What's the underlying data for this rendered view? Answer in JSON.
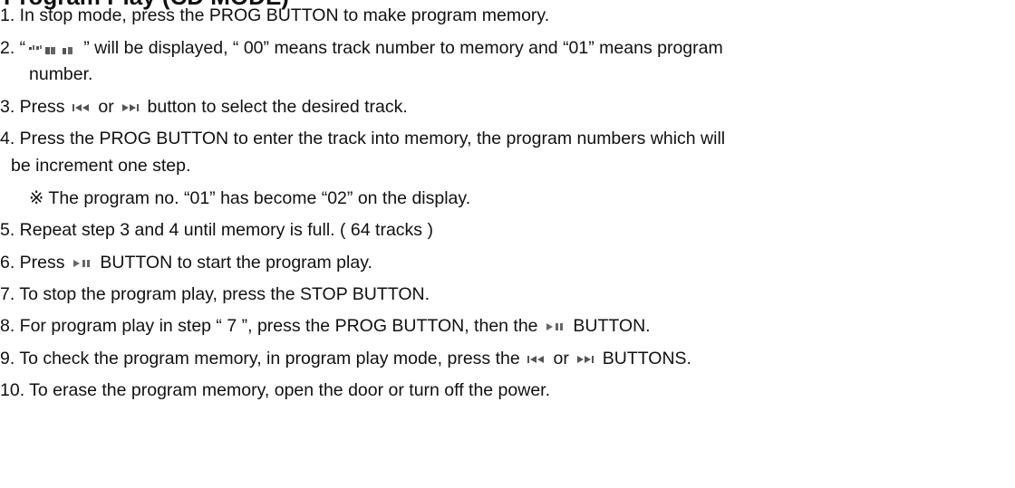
{
  "heading": "Program Play (CD MODE)",
  "steps": [
    "1. In stop mode, press the PROG BUTTON to make program memory.",
    [
      "2. “",
      "” will be displayed, “ 00” means track number to memory and “01” means program"
    ],
    "number.",
    [
      "3. Press ",
      " or ",
      " button to select the desired track."
    ],
    "4. Press the PROG BUTTON to enter the track into memory, the program numbers which will",
    "be increment one step.",
    "※  The program no. “01” has become “02” on the display.",
    "5. Repeat step 3 and 4 until memory is full. ( 64 tracks )",
    [
      "6. Press ",
      " BUTTON to start the program play."
    ],
    "7. To stop the program play, press the STOP BUTTON.",
    [
      "8. For program play in step “ 7 ”, press the PROG BUTTON, then the ",
      " BUTTON."
    ],
    [
      "9. To check the program memory, in program play mode, press the ",
      " or ",
      " BUTTONS."
    ],
    "10. To erase the program memory, open the door or turn off the power."
  ],
  "icons": {
    "display_readout": "lcd-display-icon",
    "skip_back": "skip-back-icon",
    "skip_forward": "skip-forward-icon",
    "play_pause": "play-pause-icon"
  }
}
